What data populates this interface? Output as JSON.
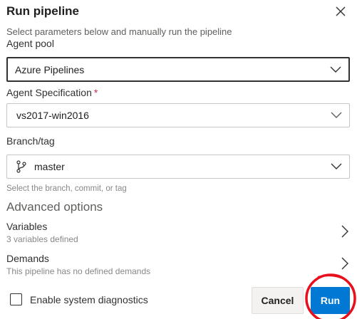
{
  "dialog": {
    "title": "Run pipeline",
    "subtitle": "Select parameters below and manually run the pipeline"
  },
  "agent_pool": {
    "label": "Agent pool",
    "value": "Azure Pipelines"
  },
  "agent_spec": {
    "label": "Agent Specification",
    "required_marker": "*",
    "value": "vs2017-win2016"
  },
  "branch": {
    "label": "Branch/tag",
    "value": "master",
    "helper": "Select the branch, commit, or tag"
  },
  "advanced": {
    "title": "Advanced options",
    "variables": {
      "title": "Variables",
      "subtitle": "3 variables defined"
    },
    "demands": {
      "title": "Demands",
      "subtitle": "This pipeline has no defined demands"
    }
  },
  "footer": {
    "diagnostics_label": "Enable system diagnostics",
    "diagnostics_checked": false,
    "cancel_label": "Cancel",
    "run_label": "Run"
  },
  "icons": {
    "close": "close-icon",
    "chevron_down": "chevron-down-icon",
    "chevron_right": "chevron-right-icon",
    "branch": "git-branch-icon"
  },
  "colors": {
    "primary": "#0078d4",
    "annotation": "#e8101c",
    "required": "#c4314b"
  }
}
